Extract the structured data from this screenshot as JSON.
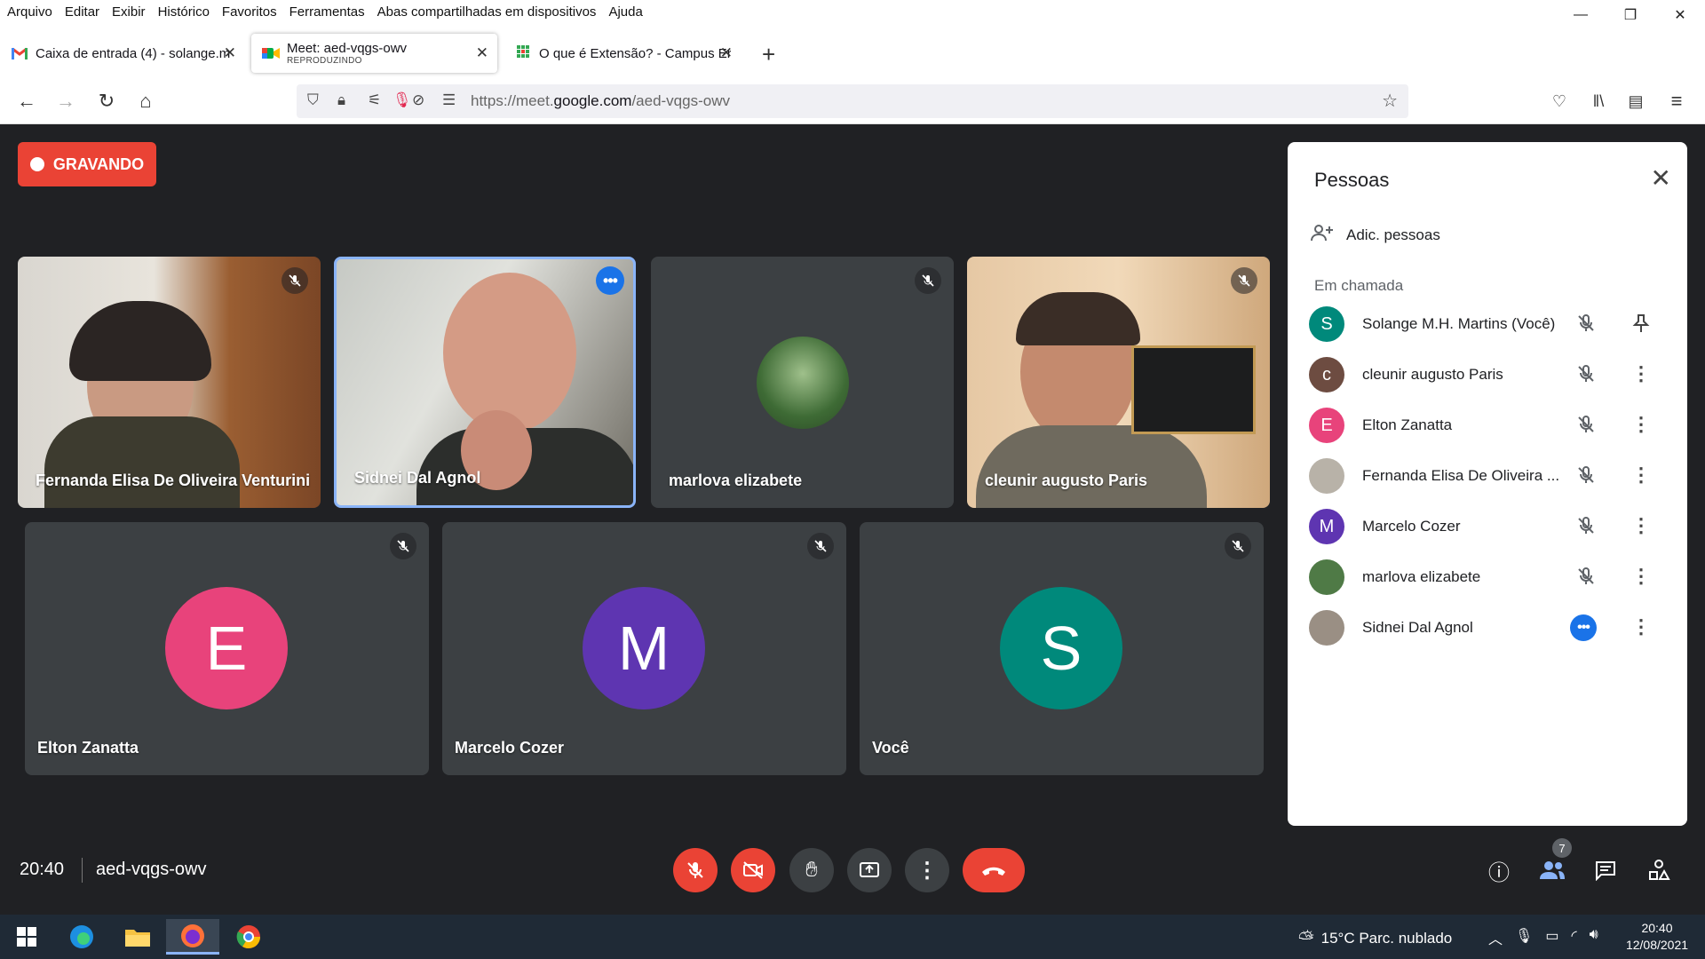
{
  "menubar": {
    "items": [
      "Arquivo",
      "Editar",
      "Exibir",
      "Histórico",
      "Favoritos",
      "Ferramentas",
      "Abas compartilhadas em dispositivos",
      "Ajuda"
    ]
  },
  "window_controls": {
    "minimize": "—",
    "restore": "❐",
    "close": "✕"
  },
  "tabs": [
    {
      "title": "Caixa de entrada (4) - solange.m",
      "icon": "gmail-icon"
    },
    {
      "title": "Meet: aed-vqgs-owv",
      "subtitle": "REPRODUZINDO",
      "icon": "meet-icon"
    },
    {
      "title": "O que é Extensão? - Campus Ere",
      "icon": "sheets-icon"
    }
  ],
  "url": {
    "prefix": "https://meet.",
    "domain": "google.com",
    "path": "/aed-vqgs-owv"
  },
  "recording": {
    "label": "GRAVANDO"
  },
  "tiles": {
    "fernanda": "Fernanda Elisa De Oliveira Venturini",
    "sidnei": "Sidnei Dal Agnol",
    "marlova": "marlova elizabete",
    "cleunir": "cleunir augusto Paris",
    "elton": {
      "name": "Elton Zanatta",
      "initial": "E",
      "color": "#e8437b"
    },
    "marcelo": {
      "name": "Marcelo Cozer",
      "initial": "M",
      "color": "#5e35b1"
    },
    "voce": {
      "name": "Você",
      "initial": "S",
      "color": "#00897b"
    }
  },
  "people_panel": {
    "title": "Pessoas",
    "add_label": "Adic. pessoas",
    "section": "Em chamada",
    "participants": [
      {
        "name": "Solange M.H. Martins (Você)",
        "initial": "S",
        "color": "#00897b"
      },
      {
        "name": "cleunir augusto Paris",
        "initial": "c",
        "color": "#6d4c41"
      },
      {
        "name": "Elton Zanatta",
        "initial": "E",
        "color": "#e8437b"
      },
      {
        "name": "Fernanda Elisa De Oliveira ...",
        "initial": "",
        "color": "#b8b2a8"
      },
      {
        "name": "Marcelo Cozer",
        "initial": "M",
        "color": "#5e35b1"
      },
      {
        "name": "marlova elizabete",
        "initial": "",
        "color": "#4f7a46"
      },
      {
        "name": "Sidnei Dal Agnol",
        "initial": "",
        "color": "#9a8f84"
      }
    ]
  },
  "bottom": {
    "time": "20:40",
    "meeting_code": "aed-vqgs-owv",
    "people_count": "7"
  },
  "taskbar": {
    "weather": "15°C  Parc. nublado",
    "time": "20:40",
    "date": "12/08/2021"
  }
}
